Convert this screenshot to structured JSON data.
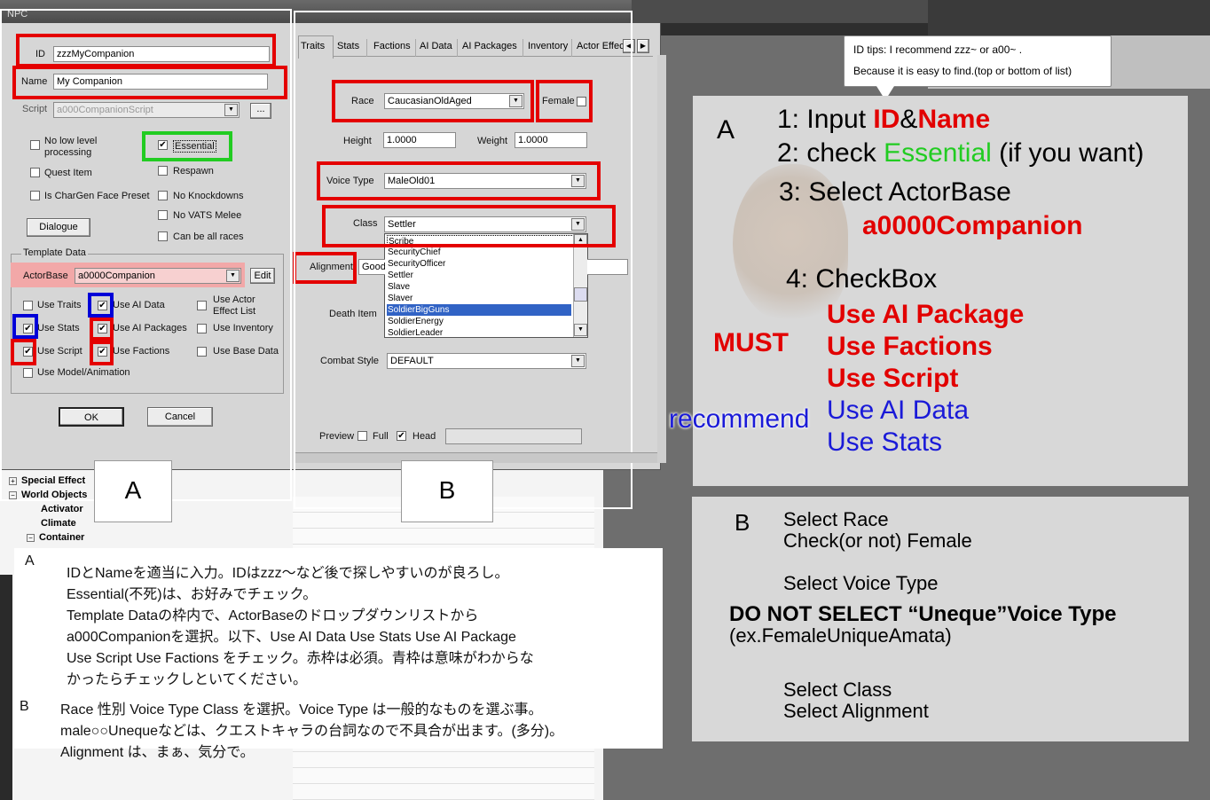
{
  "window": {
    "title": "NPC"
  },
  "form": {
    "id_label": "ID",
    "id_value": "zzzMyCompanion",
    "name_label": "Name",
    "name_value": "My Companion",
    "script_label": "Script",
    "script_value": "a000CompanionScript",
    "script_btn": "...",
    "no_low_level": "No low level processing",
    "essential": "Essential",
    "respawn": "Respawn",
    "quest_item": "Quest Item",
    "chargen": "Is CharGen Face Preset",
    "no_knockdowns": "No Knockdowns",
    "no_vats": "No VATS Melee",
    "all_races": "Can be all races",
    "dialogue_btn": "Dialogue",
    "template_label": "Template Data",
    "actorbase_label": "ActorBase",
    "actorbase_value": "a0000Companion",
    "edit_btn": "Edit",
    "use_traits": "Use Traits",
    "use_ai_data": "Use AI Data",
    "use_actor_effect": "Use Actor Effect List",
    "use_stats": "Use Stats",
    "use_ai_packages": "Use AI Packages",
    "use_inventory": "Use Inventory",
    "use_script": "Use Script",
    "use_factions": "Use Factions",
    "use_base_data": "Use Base Data",
    "use_model": "Use Model/Animation",
    "ok_btn": "OK",
    "cancel_btn": "Cancel",
    "check_mark": "✔"
  },
  "tabs": [
    "Traits",
    "Stats",
    "Factions",
    "AI Data",
    "AI Packages",
    "Inventory",
    "Actor Effec"
  ],
  "traits": {
    "race_label": "Race",
    "race_value": "CaucasianOldAged",
    "female_label": "Female",
    "height_label": "Height",
    "height_value": "1.0000",
    "weight_label": "Weight",
    "weight_value": "1.0000",
    "voice_label": "Voice Type",
    "voice_value": "MaleOld01",
    "class_label": "Class",
    "class_value": "Settler",
    "class_options": [
      "Scribe",
      "SecurityChief",
      "SecurityOfficer",
      "Settler",
      "Slave",
      "Slaver",
      "SoldierBigGuns",
      "SoldierEnergy",
      "SoldierLeader"
    ],
    "alignment_label": "Alignment",
    "alignment_value": "Good",
    "death_label": "Death Item",
    "combat_label": "Combat Style",
    "combat_value": "DEFAULT",
    "preview_label": "Preview",
    "full_label": "Full",
    "head_label": "Head"
  },
  "tree": [
    "Special Effect",
    "World Objects",
    "Activator",
    "Climate",
    "Container"
  ],
  "callouts": {
    "a": "A",
    "b": "B"
  },
  "tips": {
    "line1": "ID tips:    I recommend zzz~ or a00~ .",
    "line2": "Because it is easy to find.(top or bottom of list)"
  },
  "guide_a": {
    "letter": "A",
    "s1_pre": "1: Input ",
    "s1_id": "ID",
    "s1_amp": "&",
    "s1_name": "Name",
    "s2_pre": "2: check ",
    "s2_ess": "Essential",
    "s2_post": " (if you want)",
    "s3": "3: Select ActorBase",
    "s3_val": "a0000Companion",
    "s4": "4: CheckBox",
    "must": "MUST",
    "recommend": "recommend",
    "m1": "Use AI Package",
    "m2": "Use Factions",
    "m3": "Use Script",
    "r1": "Use AI Data",
    "r2": "Use Stats"
  },
  "guide_b": {
    "letter": "B",
    "l1": "Select Race",
    "l2": "Check(or not) Female",
    "l3": "Select Voice Type",
    "l4": "DO NOT SELECT “Uneque”Voice Type",
    "l5": "(ex.FemaleUniqueAmata)",
    "l6": "Select Class",
    "l7": "Select Alignment"
  },
  "jp": {
    "a": "A",
    "a1": "IDとNameを適当に入力。IDはzzz〜など後で探しやすいのが良ろし。",
    "a2": "Essential(不死)は、お好みでチェック。",
    "a3": "Template Dataの枠内で、ActorBaseのドロップダウンリストから",
    "a4": "a000Companionを選択。以下、Use AI Data Use Stats Use AI Package",
    "a5": "Use Script Use Factions をチェック。赤枠は必須。青枠は意味がわからな",
    "a6": "かったらチェックしといてください。",
    "b": "B",
    "b1": "Race 性別  Voice Type Class を選択。Voice Type は一般的なものを選ぶ事。",
    "b2": "male○○Unequeなどは、クエストキャラの台詞なので不具合が出ます。(多分)。",
    "b3": "Alignment は、まぁ、気分で。"
  }
}
